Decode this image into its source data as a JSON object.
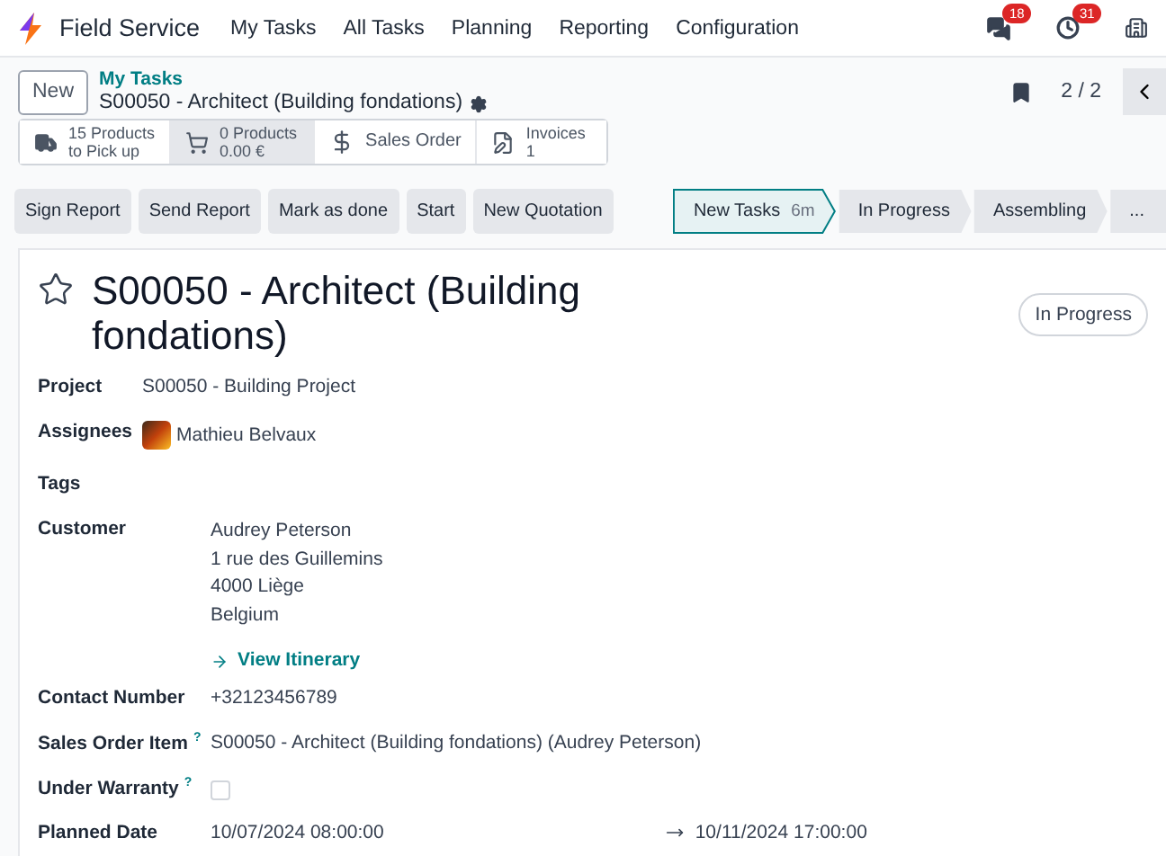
{
  "navbar": {
    "app_name": "Field Service",
    "menu": [
      "My Tasks",
      "All Tasks",
      "Planning",
      "Reporting",
      "Configuration"
    ],
    "messages_badge": "18",
    "activities_badge": "31"
  },
  "control_panel": {
    "new_button": "New",
    "breadcrumb": "My Tasks",
    "record_title": "S00050 - Architect (Building fondations)",
    "pager": "2 / 2",
    "smart_buttons": [
      {
        "kind": "truck",
        "line1": "15 Products",
        "line2": "to Pick up",
        "hovered": false
      },
      {
        "kind": "cart",
        "line1": "0 Products",
        "line2": "0.00 €",
        "hovered": true
      },
      {
        "kind": "dollar",
        "line1": "Sales Order",
        "hovered": false
      },
      {
        "kind": "invoice",
        "line1": "Invoices",
        "line2": "1",
        "hovered": false
      }
    ]
  },
  "actions": [
    "Sign Report",
    "Send Report",
    "Mark as done",
    "Start",
    "New Quotation"
  ],
  "stages": [
    {
      "label": "New Tasks",
      "duration": "6m",
      "selected": true
    },
    {
      "label": "In Progress",
      "selected": false
    },
    {
      "label": "Assembling",
      "selected": false
    },
    {
      "label": "...",
      "selected": false
    }
  ],
  "form": {
    "starred": false,
    "title": "S00050 - Architect (Building fondations)",
    "state_badge": "In Progress",
    "header_fields": [
      {
        "kind": "text",
        "label": "Project",
        "value": "S00050 - Building Project"
      },
      {
        "kind": "avatar",
        "label": "Assignees",
        "value": "Mathieu Belvaux"
      }
    ],
    "fields": [
      {
        "kind": "empty",
        "label": "Tags"
      },
      {
        "kind": "address",
        "label": "Customer",
        "lines": [
          "Audrey Peterson",
          "1 rue des Guillemins",
          "4000 Liège",
          "Belgium"
        ],
        "link": "View Itinerary"
      },
      {
        "kind": "text",
        "label": "Contact Number",
        "value": "+32123456789"
      },
      {
        "kind": "text",
        "label": "Sales Order Item",
        "help": "?",
        "value": "S00050 - Architect (Building fondations) (Audrey Peterson)"
      },
      {
        "kind": "checkbox",
        "label": "Under Warranty",
        "help": "?",
        "checked": false
      },
      {
        "kind": "daterange",
        "label": "Planned Date",
        "start": "10/07/2024 08:00:00",
        "end": "10/11/2024 17:00:00"
      }
    ]
  }
}
